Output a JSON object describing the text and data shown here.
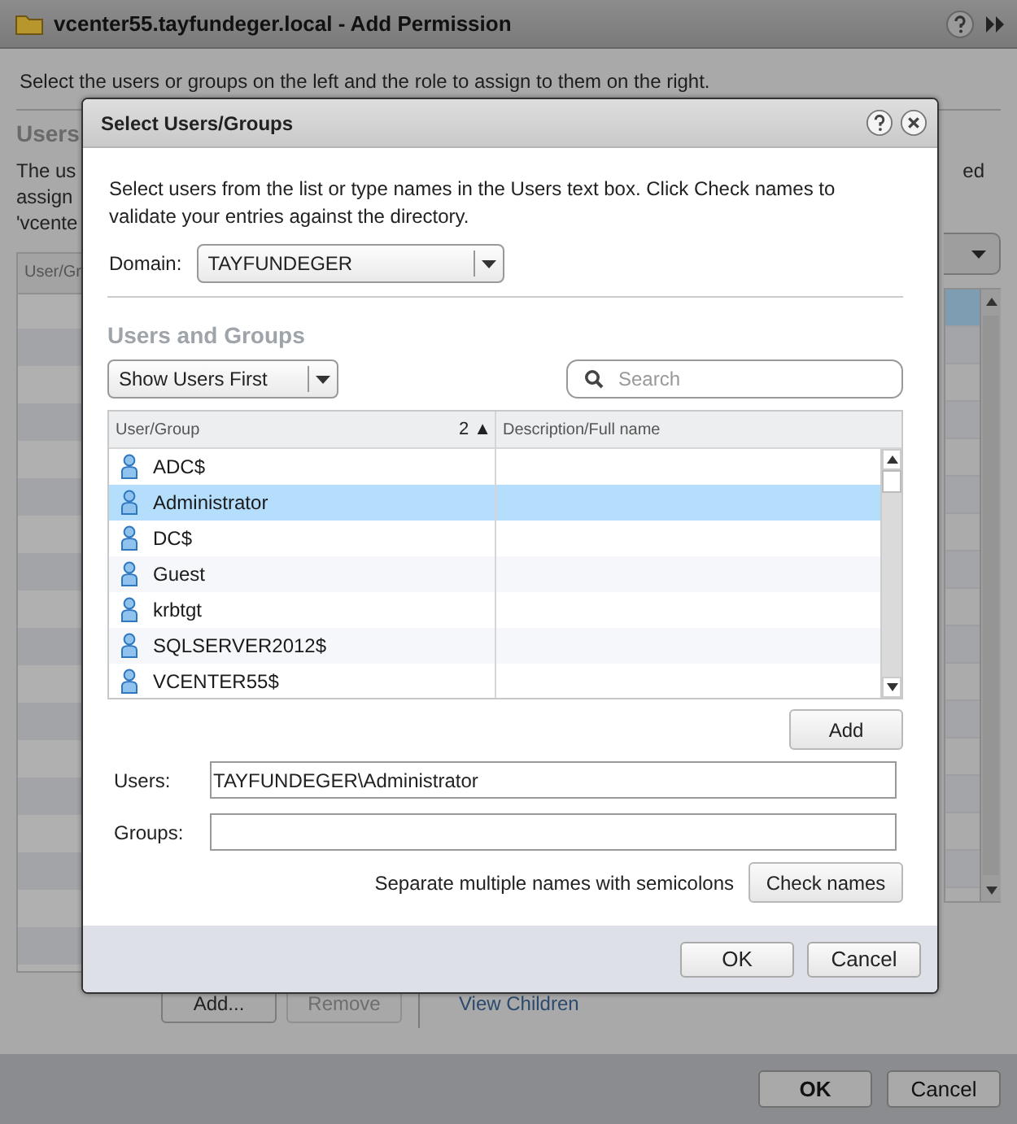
{
  "window": {
    "title": "vcenter55.tayfundeger.local - Add Permission"
  },
  "instructions": "Select the users or groups on the left and the role to assign to them on the right.",
  "users_section": {
    "heading": "Users",
    "description_lines": [
      "The us",
      "assign",
      "'vcente"
    ],
    "description_right": "ed",
    "table": {
      "columns": [
        "User/Gr"
      ]
    }
  },
  "roles_list": {
    "rows": [
      {
        "selected": true
      },
      {
        "selected": false
      },
      {
        "selected": false
      },
      {
        "selected": false
      },
      {
        "selected": false
      },
      {
        "selected": false
      },
      {
        "selected": false
      },
      {
        "selected": false
      },
      {
        "selected": false
      },
      {
        "selected": false
      },
      {
        "selected": false
      },
      {
        "selected": false
      },
      {
        "selected": false
      },
      {
        "selected": false
      },
      {
        "selected": false
      },
      {
        "selected": false
      }
    ]
  },
  "actions": [
    {
      "label": "Add...",
      "disabled": false
    },
    {
      "label": "Remove",
      "disabled": true
    }
  ],
  "link": "View Children",
  "footer_buttons": [
    "OK",
    "Cancel"
  ],
  "dialog": {
    "title": "Select Users/Groups",
    "intro": "Select users from the list or type names in the Users text box. Click Check names to validate your entries against the directory.",
    "domain": {
      "label": "Domain:",
      "value": "TAYFUNDEGER"
    },
    "section_heading": "Users and Groups",
    "filter": {
      "value": "Show Users First"
    },
    "search": {
      "placeholder": "Search"
    },
    "columns": [
      {
        "label": "User/Group",
        "sort": "2 ▲"
      },
      {
        "label": "Description/Full name"
      }
    ],
    "rows": [
      {
        "name": "ADC$",
        "selected": false
      },
      {
        "name": "Administrator",
        "selected": true
      },
      {
        "name": "DC$",
        "selected": false
      },
      {
        "name": "Guest",
        "selected": false
      },
      {
        "name": "krbtgt",
        "selected": false
      },
      {
        "name": "SQLSERVER2012$",
        "selected": false
      },
      {
        "name": "VCENTER55$",
        "selected": false
      }
    ],
    "add_button": "Add",
    "users": {
      "label": "Users:",
      "value": "TAYFUNDEGER\\Administrator"
    },
    "groups": {
      "label": "Groups:"
    },
    "hint": "Separate multiple names with semicolons",
    "check_button": "Check names",
    "buttons": [
      "OK",
      "Cancel"
    ]
  }
}
